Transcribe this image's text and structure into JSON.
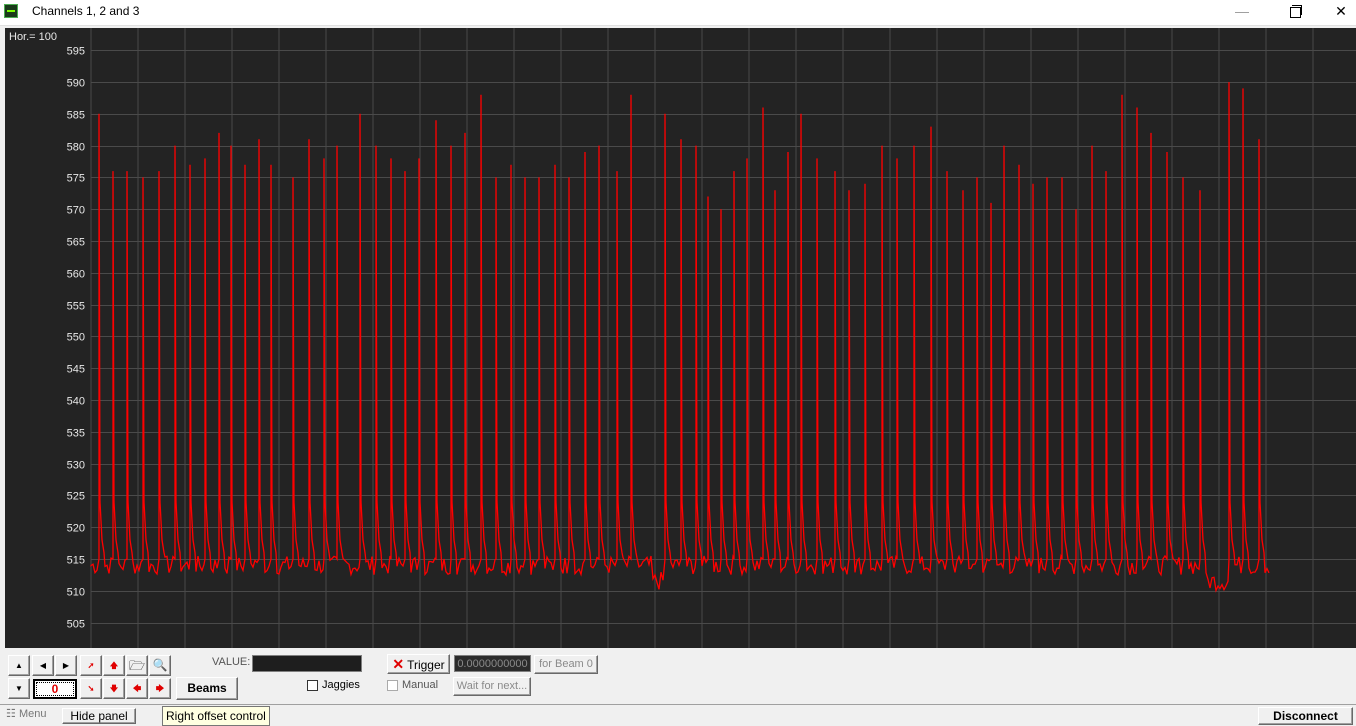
{
  "window": {
    "title": "Channels 1, 2 and 3",
    "min_glyph": "—",
    "close_glyph": "✕"
  },
  "scope": {
    "hor_label": "Hor.= 100",
    "background_color": "#232323",
    "grid_color": "#4a4a4a",
    "trace_color": "#ff0000"
  },
  "chart_data": {
    "type": "line",
    "title": "",
    "xlabel": "",
    "ylabel": "",
    "y_ticks": [
      "595",
      "590",
      "585",
      "580",
      "575",
      "570",
      "565",
      "560",
      "555",
      "550",
      "545",
      "540",
      "535",
      "530",
      "525",
      "520",
      "515",
      "510",
      "505"
    ],
    "ylim": [
      501,
      598.5
    ],
    "x_range": [
      0,
      1200
    ],
    "grid": true,
    "baseline": 514,
    "series": [
      {
        "values_description_free": true,
        "peaks": [
          {
            "x": 8,
            "y": 585
          },
          {
            "x": 22,
            "y": 576
          },
          {
            "x": 36,
            "y": 576
          },
          {
            "x": 52,
            "y": 575
          },
          {
            "x": 68,
            "y": 576
          },
          {
            "x": 84,
            "y": 580
          },
          {
            "x": 99,
            "y": 577
          },
          {
            "x": 114,
            "y": 578
          },
          {
            "x": 128,
            "y": 582
          },
          {
            "x": 140,
            "y": 580
          },
          {
            "x": 154,
            "y": 577
          },
          {
            "x": 168,
            "y": 581
          },
          {
            "x": 180,
            "y": 577
          },
          {
            "x": 202,
            "y": 575
          },
          {
            "x": 218,
            "y": 581
          },
          {
            "x": 233,
            "y": 578
          },
          {
            "x": 246,
            "y": 580
          },
          {
            "x": 269,
            "y": 585
          },
          {
            "x": 285,
            "y": 580
          },
          {
            "x": 300,
            "y": 578
          },
          {
            "x": 314,
            "y": 576
          },
          {
            "x": 328,
            "y": 578
          },
          {
            "x": 345,
            "y": 584
          },
          {
            "x": 360,
            "y": 580
          },
          {
            "x": 374,
            "y": 582
          },
          {
            "x": 390,
            "y": 588
          },
          {
            "x": 405,
            "y": 575
          },
          {
            "x": 420,
            "y": 577
          },
          {
            "x": 434,
            "y": 575
          },
          {
            "x": 448,
            "y": 575
          },
          {
            "x": 464,
            "y": 577
          },
          {
            "x": 478,
            "y": 575
          },
          {
            "x": 494,
            "y": 579
          },
          {
            "x": 508,
            "y": 580
          },
          {
            "x": 526,
            "y": 576
          },
          {
            "x": 540,
            "y": 588
          },
          {
            "x": 574,
            "y": 585
          },
          {
            "x": 590,
            "y": 581
          },
          {
            "x": 605,
            "y": 580
          },
          {
            "x": 617,
            "y": 572
          },
          {
            "x": 630,
            "y": 570
          },
          {
            "x": 643,
            "y": 576
          },
          {
            "x": 656,
            "y": 578
          },
          {
            "x": 672,
            "y": 586
          },
          {
            "x": 684,
            "y": 573
          },
          {
            "x": 697,
            "y": 579
          },
          {
            "x": 710,
            "y": 585
          },
          {
            "x": 726,
            "y": 578
          },
          {
            "x": 744,
            "y": 576
          },
          {
            "x": 758,
            "y": 573
          },
          {
            "x": 774,
            "y": 574
          },
          {
            "x": 791,
            "y": 580
          },
          {
            "x": 806,
            "y": 578
          },
          {
            "x": 823,
            "y": 580
          },
          {
            "x": 840,
            "y": 583
          },
          {
            "x": 856,
            "y": 576
          },
          {
            "x": 872,
            "y": 573
          },
          {
            "x": 886,
            "y": 575
          },
          {
            "x": 900,
            "y": 571
          },
          {
            "x": 913,
            "y": 580
          },
          {
            "x": 928,
            "y": 577
          },
          {
            "x": 942,
            "y": 574
          },
          {
            "x": 956,
            "y": 575
          },
          {
            "x": 971,
            "y": 575
          },
          {
            "x": 985,
            "y": 570
          },
          {
            "x": 1001,
            "y": 580
          },
          {
            "x": 1015,
            "y": 576
          },
          {
            "x": 1031,
            "y": 588
          },
          {
            "x": 1046,
            "y": 586
          },
          {
            "x": 1060,
            "y": 582
          },
          {
            "x": 1076,
            "y": 579
          },
          {
            "x": 1092,
            "y": 575
          },
          {
            "x": 1109,
            "y": 573
          },
          {
            "x": 1138,
            "y": 590
          },
          {
            "x": 1152,
            "y": 589
          },
          {
            "x": 1168,
            "y": 581
          }
        ]
      }
    ]
  },
  "panel": {
    "offset_value": "0",
    "beams_label": "Beams",
    "value_label": "VALUE:",
    "jaggies_label": "Jaggies",
    "trigger_label": "Trigger",
    "trigger_value": "0.0000000000",
    "for_beam_label": "for Beam 0",
    "manual_label": "Manual",
    "wait_label": "Wait for next...",
    "glyphs": {
      "up": "▲",
      "down": "▼",
      "left": "◀",
      "right": "▶",
      "diag_up": "➚",
      "diag_down": "➘",
      "arrow_up": "🡅",
      "arrow_down": "🡇",
      "arrow_left": "🡄",
      "arrow_right": "🡆",
      "folder": "🗁",
      "zoom": "🔍",
      "x_mark": "✕",
      "menu_icon": "☷"
    }
  },
  "status": {
    "menu_label": "Menu",
    "hide_panel_label": "Hide panel",
    "tooltip_text": "Right offset control",
    "disconnect_label": "Disconnect"
  }
}
